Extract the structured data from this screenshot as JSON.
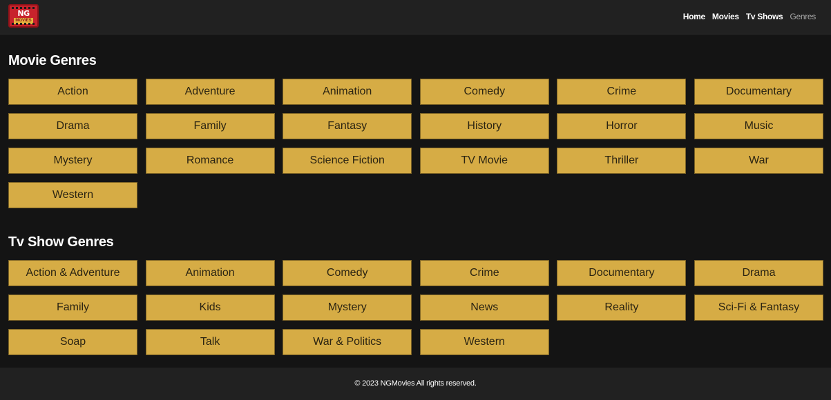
{
  "brand": {
    "logo_text": "NG",
    "logo_sub": "MOVIES"
  },
  "nav": {
    "items": [
      {
        "label": "Home"
      },
      {
        "label": "Movies"
      },
      {
        "label": "Tv Shows"
      },
      {
        "label": "Genres"
      }
    ],
    "active": "Genres"
  },
  "movie_genres": {
    "title": "Movie Genres",
    "items": [
      "Action",
      "Adventure",
      "Animation",
      "Comedy",
      "Crime",
      "Documentary",
      "Drama",
      "Family",
      "Fantasy",
      "History",
      "Horror",
      "Music",
      "Mystery",
      "Romance",
      "Science Fiction",
      "TV Movie",
      "Thriller",
      "War",
      "Western"
    ]
  },
  "tv_genres": {
    "title": "Tv Show Genres",
    "items": [
      "Action & Adventure",
      "Animation",
      "Comedy",
      "Crime",
      "Documentary",
      "Drama",
      "Family",
      "Kids",
      "Mystery",
      "News",
      "Reality",
      "Sci-Fi & Fantasy",
      "Soap",
      "Talk",
      "War & Politics",
      "Western"
    ]
  },
  "footer": {
    "text": "© 2023 NGMovies All rights reserved."
  },
  "colors": {
    "background": "#141414",
    "header": "#212121",
    "chip": "#d6ac45",
    "chip_text": "#2b2412",
    "logo_red": "#c8232c"
  }
}
